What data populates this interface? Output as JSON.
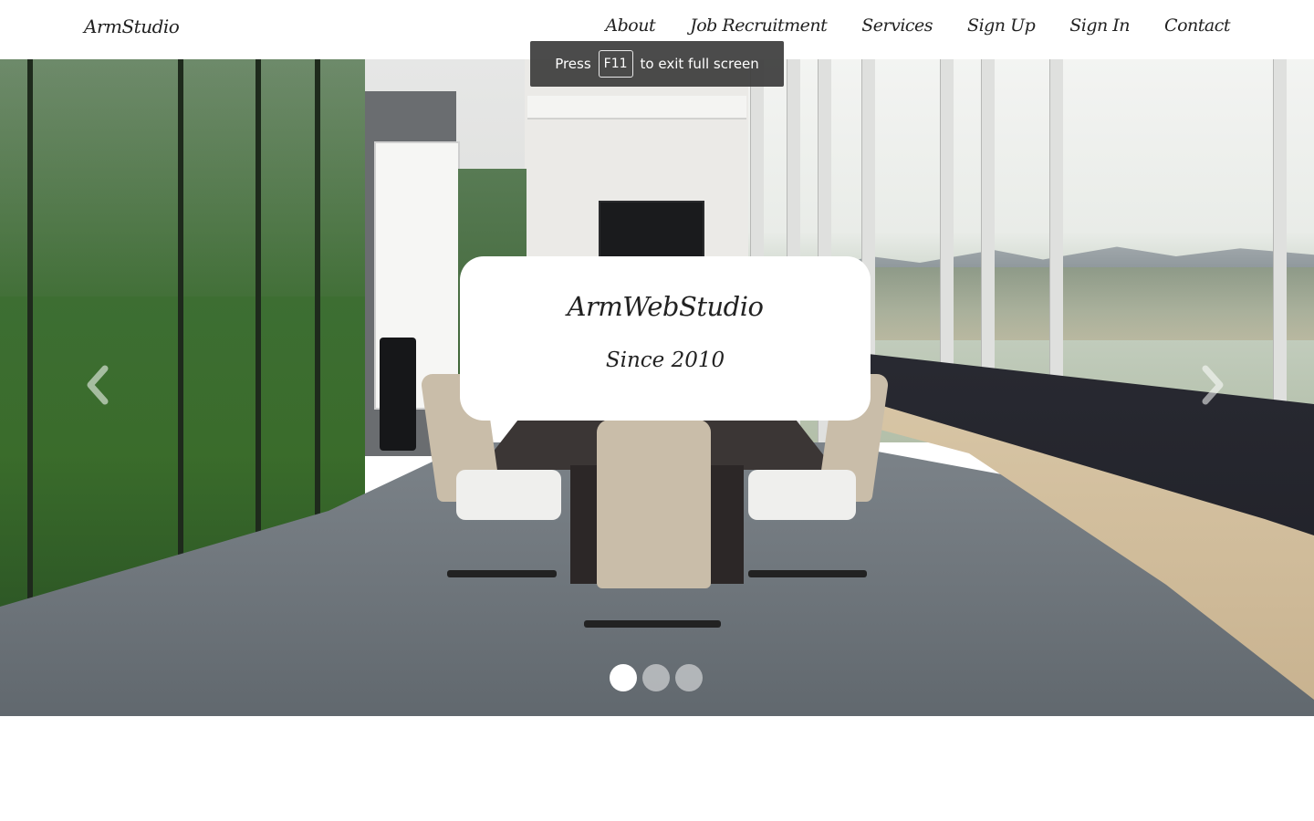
{
  "navbar": {
    "brand": "ArmStudio",
    "links": [
      "About",
      "Job Recruitment",
      "Services",
      "Sign Up",
      "Sign In",
      "Contact"
    ]
  },
  "fullscreen_toast": {
    "press": "Press",
    "key": "F11",
    "suffix": "to exit full screen"
  },
  "carousel": {
    "caption_title": "ArmWebStudio",
    "caption_subtitle": "Since 2010",
    "prev_icon": "chevron-left-icon",
    "next_icon": "chevron-right-icon",
    "slide_count": 3,
    "active_slide": 1
  },
  "colors": {
    "navbar_bg": "#ffffff",
    "text": "#222222",
    "toast_bg": "#3c3c3c"
  }
}
